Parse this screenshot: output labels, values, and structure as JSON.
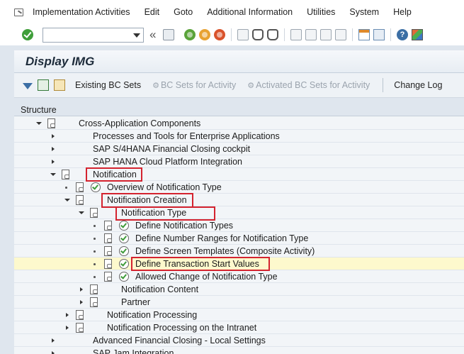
{
  "menubar": {
    "icon": "menu-window-icon",
    "items": [
      "Implementation Activities",
      "Edit",
      "Goto",
      "Additional Information",
      "Utilities",
      "System",
      "Help"
    ]
  },
  "toolbar": {
    "command_field_value": "",
    "icons": [
      "enter-check-icon",
      "save-icon",
      "back-icon",
      "exit-icon",
      "cancel-icon",
      "print-icon",
      "find-icon",
      "find-next-icon",
      "first-page-icon",
      "previous-page-icon",
      "next-page-icon",
      "last-page-icon",
      "create-session-icon",
      "shortcut-icon",
      "help-icon",
      "customize-layout-icon"
    ]
  },
  "title": "Display IMG",
  "app_toolbar": {
    "existing_bc_sets": "Existing BC Sets",
    "bc_sets_for_activity": "BC Sets for Activity",
    "activated_bc_sets": "Activated BC Sets for Activity",
    "change_log": "Change Log"
  },
  "tree": {
    "header": "Structure",
    "rows": [
      {
        "label": "Cross-Application Components"
      },
      {
        "label": "Processes and Tools for Enterprise Applications"
      },
      {
        "label": "SAP S/4HANA Financial Closing cockpit"
      },
      {
        "label": "SAP HANA Cloud Platform Integration"
      },
      {
        "label": "Notification"
      },
      {
        "label": "Overview of Notification Type"
      },
      {
        "label": "Notification Creation"
      },
      {
        "label": "Notification Type"
      },
      {
        "label": "Define Notification Types"
      },
      {
        "label": "Define Number Ranges for Notification Type"
      },
      {
        "label": "Define Screen Templates (Composite Activity)"
      },
      {
        "label": "Define Transaction Start Values"
      },
      {
        "label": "Allowed Change of Notification Type"
      },
      {
        "label": "Notification Content"
      },
      {
        "label": "Partner"
      },
      {
        "label": "Notification Processing"
      },
      {
        "label": "Notification Processing on the Intranet"
      },
      {
        "label": "Advanced Financial Closing - Local Settings"
      },
      {
        "label": "SAP Jam Integration"
      }
    ]
  },
  "colors": {
    "highlight_box": "#d4232f",
    "selected_row": "#fdf9cd",
    "execute_check": "#3e9a3a"
  }
}
